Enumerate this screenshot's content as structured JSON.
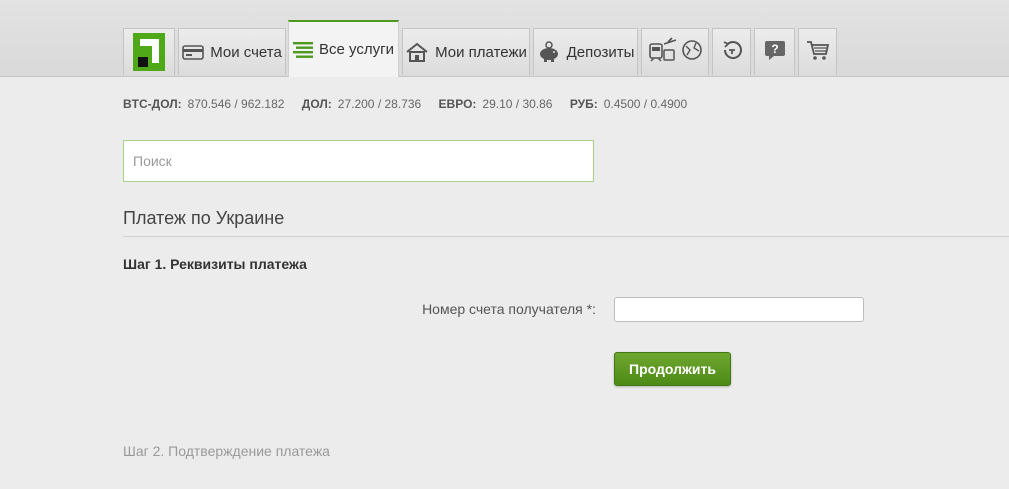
{
  "nav": {
    "tabs": [
      {
        "label": "Мои счета",
        "icon": "card-icon"
      },
      {
        "label": "Все услуги",
        "icon": "list-icon",
        "active": true
      },
      {
        "label": "Мои платежи",
        "icon": "house-icon"
      },
      {
        "label": "Депозиты",
        "icon": "piggy-bank-icon"
      }
    ],
    "icon_tabs": [
      "travel-icon",
      "history-icon",
      "help-icon",
      "cart-icon"
    ],
    "help_glyph": "?"
  },
  "rates": [
    {
      "label": "BTC-ДОЛ:",
      "value": "870.546 / 962.182"
    },
    {
      "label": "ДОЛ:",
      "value": "27.200 / 28.736"
    },
    {
      "label": "ЕВРО:",
      "value": "29.10 / 30.86"
    },
    {
      "label": "РУБ:",
      "value": "0.4500 / 0.4900"
    }
  ],
  "search": {
    "placeholder": "Поиск",
    "value": ""
  },
  "page": {
    "title": "Платеж по Украине",
    "step1": "Шаг 1. Реквизиты платежа",
    "field_label": "Номер счета получателя *:",
    "field_value": "",
    "submit": "Продолжить",
    "step2": "Шаг 2. Подтверждение платежа"
  },
  "colors": {
    "accent": "#4ea818",
    "button": "#5a961f"
  }
}
